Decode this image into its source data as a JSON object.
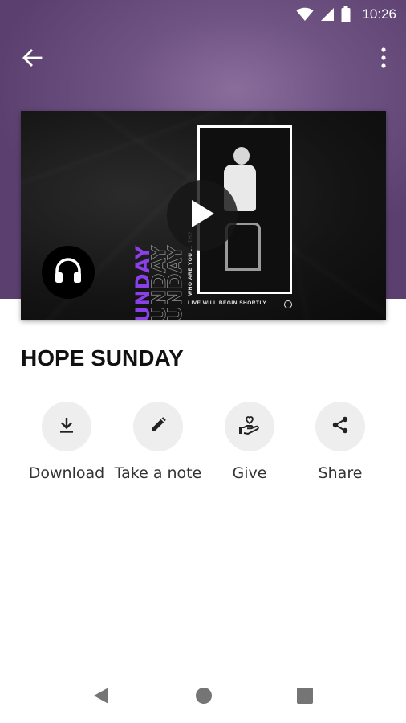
{
  "status_bar": {
    "time": "10:26",
    "icons": [
      "wifi-icon",
      "signal-icon",
      "battery-icon"
    ]
  },
  "app_bar": {
    "back_icon": "arrow-back-icon",
    "menu_icon": "more-vert-icon"
  },
  "media": {
    "poster_title": "HOPE SUNDAY",
    "poster_side_text": "WHO ARE YOU ... TH?",
    "poster_caption": "LIVE WILL BEGIN SHORTLY",
    "play_icon": "play-icon",
    "audio_icon": "headphones-icon"
  },
  "sermon": {
    "title": "HOPE SUNDAY"
  },
  "actions": [
    {
      "label": "Download",
      "icon": "download-icon"
    },
    {
      "label": "Take a note",
      "icon": "pencil-icon"
    },
    {
      "label": "Give",
      "icon": "give-heart-hand-icon"
    },
    {
      "label": "Share",
      "icon": "share-icon"
    }
  ],
  "nav_bar": {
    "back_icon": "nav-back-icon",
    "home_icon": "nav-home-icon",
    "recents_icon": "nav-recents-icon"
  },
  "colors": {
    "header_purple": "#6f5383",
    "poster_accent": "#8b3fe8",
    "action_bg": "#eeeeee"
  }
}
